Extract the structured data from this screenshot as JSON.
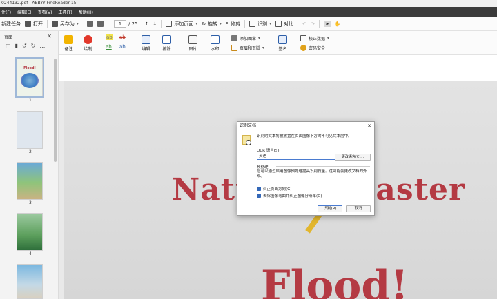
{
  "window": {
    "title": "0244132.pdf - ABBYY FineReader 15"
  },
  "menu": [
    "件(F)",
    "编辑(E)",
    "查看(V)",
    "工具(T)",
    "帮助(H)"
  ],
  "toolbar": {
    "new_task": "新建任务",
    "open": "打开",
    "save_as": "另存为",
    "page_current": "1",
    "page_total": "/ 25",
    "add_page": "添加页面",
    "rotate": "旋转",
    "crop": "修剪",
    "recognize": "识别",
    "compare": "对比"
  },
  "ribbon": {
    "note": "备注",
    "draw": "绘制",
    "edit": "编辑",
    "erase": "擦除",
    "image": "图片",
    "watermark": "水印",
    "add_figure": "添加图章",
    "header_footer": "页眉和页脚",
    "sign": "签名",
    "proofread": "校正数据",
    "password_security": "密码安全"
  },
  "sidebar": {
    "title": "页面",
    "pages": [
      {
        "num": "1",
        "title": "Flood!"
      },
      {
        "num": "2"
      },
      {
        "num": "3"
      },
      {
        "num": "4"
      }
    ]
  },
  "document": {
    "title_text": "Natural Disaster",
    "word": "Flood!"
  },
  "dialog": {
    "title": "识别文档",
    "message": "识别的文本将被放置在页面图像下方的不可见文本层中。",
    "ocr_label": "OCR 语言(S):",
    "ocr_value": "英语",
    "more_languages": "更改语言(C)...",
    "preprocess_label": "预处理",
    "preprocess_help": "您可以通过启用图像预处理提高识别质量。这可能会更改文档的外观。",
    "checkbox1": "纠正页面方向(G)",
    "checkbox2": "去除图像弯曲并纠正图像分辨率(D)",
    "ok": "识别(R)",
    "cancel": "取消"
  }
}
